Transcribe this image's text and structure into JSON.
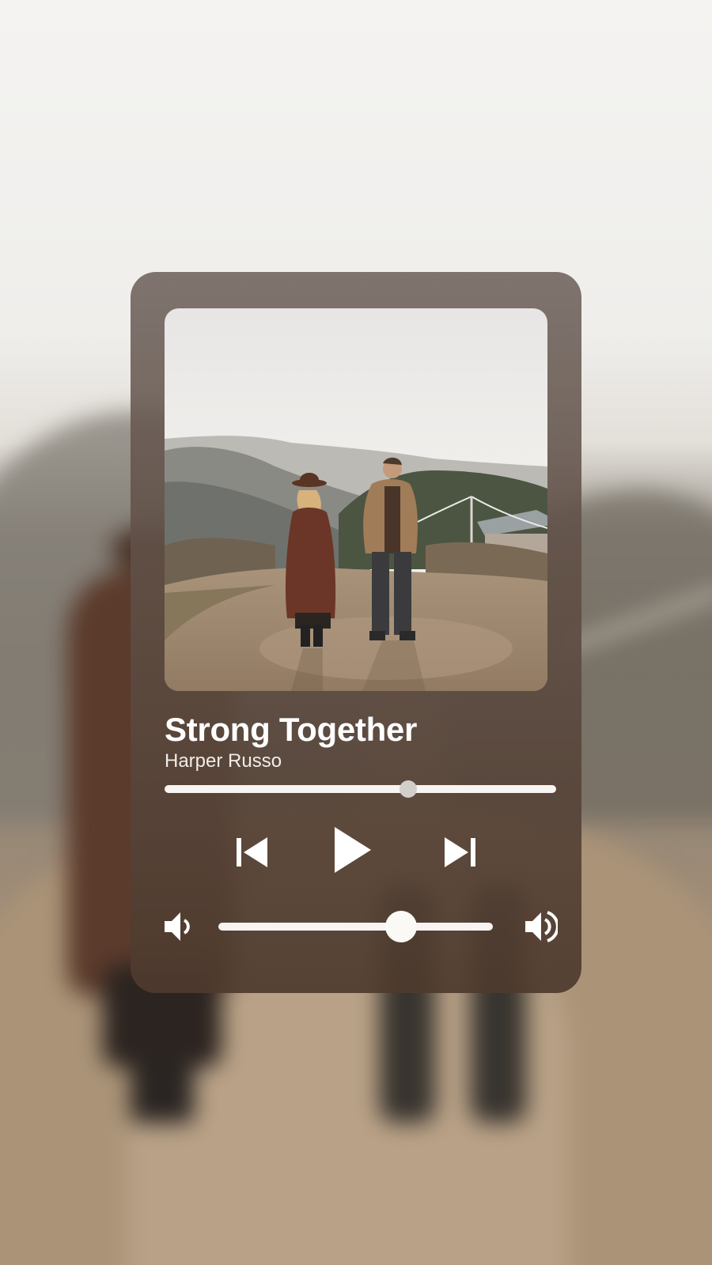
{
  "player": {
    "song_title": "Strong Together",
    "artist": "Harper Russo",
    "progress": 0.623,
    "volume": 0.665
  },
  "icons": {
    "previous": "skip-previous-icon",
    "play": "play-icon",
    "next": "skip-next-icon",
    "volume_low": "volume-low-icon",
    "volume_high": "volume-high-icon"
  },
  "colors": {
    "card": "#6b5a51",
    "foreground": "#ffffff",
    "track": "#f7f4f1"
  }
}
